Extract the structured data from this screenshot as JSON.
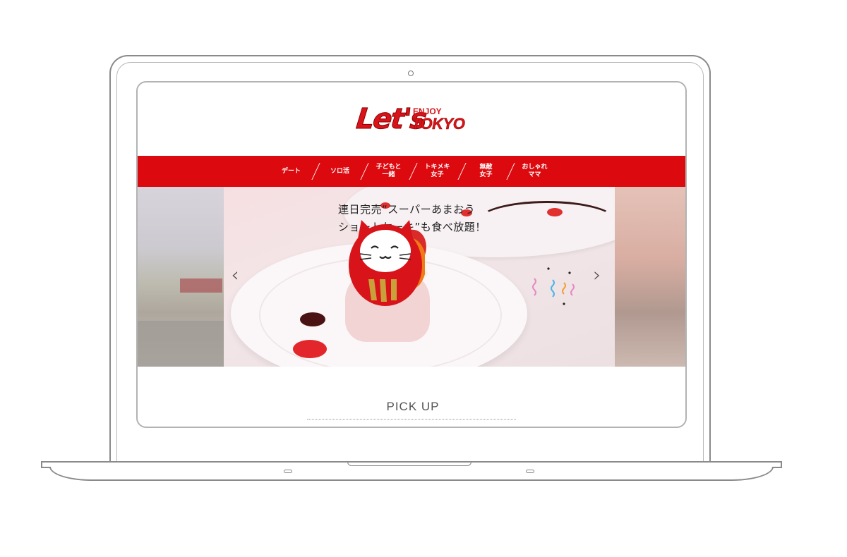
{
  "site": {
    "logo_lets": "Let's",
    "logo_enjoy": "ENJOY",
    "logo_tokyo": "TOKYO"
  },
  "nav": {
    "items": [
      {
        "label": "デート"
      },
      {
        "label": "ソロ活"
      },
      {
        "label": "子どもと\n一緒"
      },
      {
        "label": "トキメキ\n女子"
      },
      {
        "label": "無敵\n女子"
      },
      {
        "label": "おしゃれ\nママ"
      }
    ]
  },
  "slider": {
    "caption_line1": "連日完売“スーパーあまおう",
    "caption_line2": "ショートケーキ”も食べ放題！",
    "prev_icon": "‹",
    "next_icon": "›"
  },
  "section": {
    "pickup_title": "PICK UP"
  },
  "colors": {
    "brand_red": "#dc0a0f",
    "nav_text": "#ffffff"
  },
  "icons": {
    "prev": "chevron-left-icon",
    "next": "chevron-right-icon",
    "mascot": "daruma-cat-icon"
  }
}
